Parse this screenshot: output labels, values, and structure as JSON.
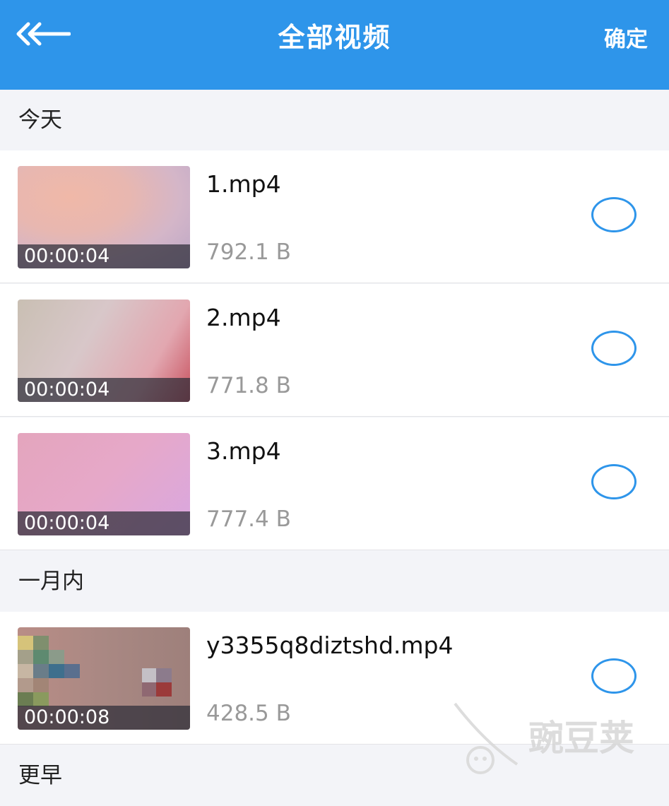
{
  "header": {
    "title": "全部视频",
    "confirm_label": "确定",
    "back_icon": "double-chevron-left-icon"
  },
  "sections": [
    {
      "label": "今天",
      "items": [
        {
          "name": "1.mp4",
          "size": "792.1 B",
          "duration": "00:00:04",
          "selected": false
        },
        {
          "name": "2.mp4",
          "size": "771.8 B",
          "duration": "00:00:04",
          "selected": false
        },
        {
          "name": "3.mp4",
          "size": "777.4 B",
          "duration": "00:00:04",
          "selected": false
        }
      ]
    },
    {
      "label": "一月内",
      "items": [
        {
          "name": "y3355q8diztshd.mp4",
          "size": "428.5 B",
          "duration": "00:00:08",
          "selected": false
        }
      ]
    },
    {
      "label": "更早",
      "items": []
    }
  ],
  "watermark": {
    "text": "豌豆荚"
  },
  "colors": {
    "accent": "#2e95ea",
    "background": "#f3f4f8"
  }
}
